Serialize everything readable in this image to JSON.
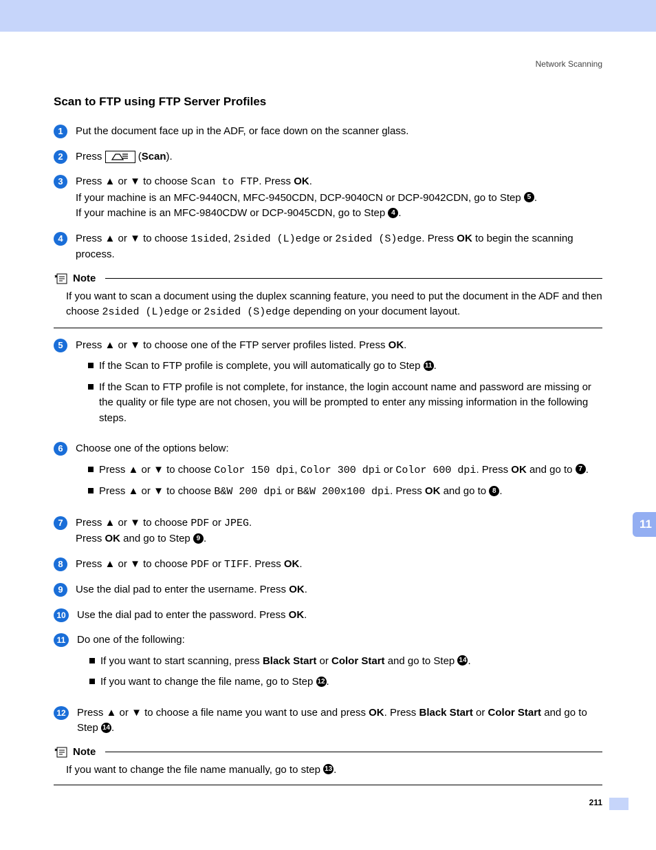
{
  "header": {
    "section": "Network Scanning"
  },
  "title": "Scan to FTP using FTP Server Profiles",
  "sideTab": "11",
  "pageNumber": "211",
  "scanLabel": "Scan",
  "arrows": {
    "up": "▲",
    "down": "▼"
  },
  "steps": {
    "s1": "Put the document face up in the ADF, or face down on the scanner glass.",
    "s2_pre": "Press ",
    "s2_post": ").",
    "s2_open": " (",
    "s3a": "Press ",
    "s3b": " or ",
    "s3c": " to choose ",
    "s3_code": "Scan to FTP",
    "s3d": ". Press ",
    "s3_ok": "OK",
    "s3e": ".",
    "s3_line2a": "If your machine is an MFC-9440CN, MFC-9450CDN, DCP-9040CN or DCP-9042CDN, go to Step ",
    "s3_line2b": ".",
    "s3_line3a": "If your machine is an MFC-9840CDW or DCP-9045CDN, go to Step ",
    "s3_line3b": ".",
    "s4a": "Press ",
    "s4b": " or ",
    "s4c": " to choose ",
    "s4_code1": "1sided",
    "s4_sep": ", ",
    "s4_code2": "2sided (L)edge",
    "s4_or": " or ",
    "s4_code3": "2sided (S)edge",
    "s4d": ".  Press ",
    "s4_ok": "OK",
    "s4e": " to begin the scanning process.",
    "note1_title": "Note",
    "note1a": "If you want to scan a document using the duplex scanning feature, you need to put the document in the ADF and then choose ",
    "note1_code1": "2sided (L)edge",
    "note1b": " or ",
    "note1_code2": "2sided (S)edge",
    "note1c": " depending on your document layout.",
    "s5a": "Press ",
    "s5b": " or ",
    "s5c": " to choose one of the FTP server profiles listed.  Press ",
    "s5_ok": "OK",
    "s5d": ".",
    "s5_b1a": "If the Scan to FTP profile is complete, you will automatically go to Step ",
    "s5_b1b": ".",
    "s5_b2": "If the Scan to FTP profile is not complete, for instance, the login account name and password are missing or the quality or file type are not chosen, you will be prompted to enter any missing information in the following steps.",
    "s6": "Choose one of the options below:",
    "s6_b1a": "Press ",
    "s6_b1b": " or ",
    "s6_b1c": " to choose ",
    "s6_b1_c1": "Color 150 dpi",
    "s6_b1_sep": ", ",
    "s6_b1_c2": "Color 300 dpi",
    "s6_b1_or": " or ",
    "s6_b1_c3": "Color 600 dpi",
    "s6_b1d": ". Press ",
    "s6_b1_ok": "OK",
    "s6_b1e": " and go to ",
    "s6_b1f": ".",
    "s6_b2a": "Press ",
    "s6_b2b": " or ",
    "s6_b2c": " to choose ",
    "s6_b2_c1": "B&W 200 dpi",
    "s6_b2_or": " or ",
    "s6_b2_c2": "B&W 200x100 dpi",
    "s6_b2d": ". Press ",
    "s6_b2_ok": "OK",
    "s6_b2e": " and go to ",
    "s6_b2f": ".",
    "s7a": "Press ",
    "s7b": " or ",
    "s7c": " to choose ",
    "s7_c1": "PDF",
    "s7_or": " or ",
    "s7_c2": "JPEG",
    "s7d": ".",
    "s7_line2a": "Press ",
    "s7_line2_ok": "OK",
    "s7_line2b": " and go to Step ",
    "s7_line2c": ".",
    "s8a": "Press ",
    "s8b": " or ",
    "s8c": " to choose ",
    "s8_c1": "PDF",
    "s8_or": " or ",
    "s8_c2": "TIFF",
    "s8d": ".  Press ",
    "s8_ok": "OK",
    "s8e": ".",
    "s9a": "Use the dial pad to enter the username. Press ",
    "s9_ok": "OK",
    "s9b": ".",
    "s10a": "Use the dial pad to enter the password. Press ",
    "s10_ok": "OK",
    "s10b": ".",
    "s11": "Do one of the following:",
    "s11_b1a": "If you want to start scanning, press ",
    "s11_b1_bs": "Black Start",
    "s11_b1b": " or ",
    "s11_b1_cs": "Color Start",
    "s11_b1c": " and go to Step ",
    "s11_b1d": ".",
    "s11_b2a": "If you want to change the file name, go to Step ",
    "s11_b2b": ".",
    "s12a": "Press ",
    "s12b": " or ",
    "s12c": " to choose a file name you want to use and press ",
    "s12_ok": "OK",
    "s12d": ". Press ",
    "s12_bs": "Black Start",
    "s12e": " or ",
    "s12_cs": "Color Start",
    "s12f": " and go to Step ",
    "s12g": ".",
    "note2_title": "Note",
    "note2a": "If you want to change the file name manually, go to step ",
    "note2b": "."
  },
  "refs": {
    "r4": "4",
    "r5": "5",
    "r7": "7",
    "r8": "8",
    "r9": "9",
    "r11": "11",
    "r12": "12",
    "r13": "13",
    "r14": "14"
  }
}
